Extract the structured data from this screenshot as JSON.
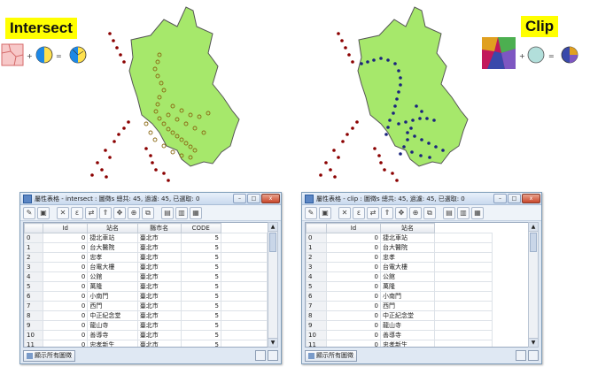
{
  "left_panel": {
    "label": "Intersect",
    "window": {
      "title": "屬性表格 - intersect : 圖徵s 總共: 45, 過濾: 45, 已選取: 0",
      "columns": [
        "Id",
        "站名",
        "縣市名",
        "CODE"
      ],
      "rows": [
        [
          "0",
          "0",
          "捷北車站",
          "臺北市",
          "5"
        ],
        [
          "1",
          "0",
          "台大醫院",
          "臺北市",
          "5"
        ],
        [
          "2",
          "0",
          "忠孝",
          "臺北市",
          "5"
        ],
        [
          "3",
          "0",
          "台電大樓",
          "臺北市",
          "5"
        ],
        [
          "4",
          "0",
          "公館",
          "臺北市",
          "5"
        ],
        [
          "5",
          "0",
          "萬隆",
          "臺北市",
          "5"
        ],
        [
          "6",
          "0",
          "小南門",
          "臺北市",
          "5"
        ],
        [
          "7",
          "0",
          "西門",
          "臺北市",
          "5"
        ],
        [
          "8",
          "0",
          "中正紀念堂",
          "臺北市",
          "5"
        ],
        [
          "9",
          "0",
          "龍山寺",
          "臺北市",
          "5"
        ],
        [
          "10",
          "0",
          "善導寺",
          "臺北市",
          "5"
        ],
        [
          "11",
          "0",
          "忠孝新生",
          "臺北市",
          "5"
        ]
      ],
      "show_all_button": "顯示所有圖徵"
    }
  },
  "right_panel": {
    "label": "Clip",
    "window": {
      "title": "屬性表格 - clip : 圖徵s 總共: 45, 過濾: 45, 已選取: 0",
      "columns": [
        "Id",
        "站名"
      ],
      "rows": [
        [
          "0",
          "0",
          "捷北車站"
        ],
        [
          "1",
          "0",
          "台大醫院"
        ],
        [
          "2",
          "0",
          "忠孝"
        ],
        [
          "3",
          "0",
          "台電大樓"
        ],
        [
          "4",
          "0",
          "公館"
        ],
        [
          "5",
          "0",
          "萬隆"
        ],
        [
          "6",
          "0",
          "小南門"
        ],
        [
          "7",
          "0",
          "西門"
        ],
        [
          "8",
          "0",
          "中正紀念堂"
        ],
        [
          "9",
          "0",
          "龍山寺"
        ],
        [
          "10",
          "0",
          "善導寺"
        ],
        [
          "11",
          "0",
          "忠孝新生"
        ]
      ],
      "show_all_button": "顯示所有圖徵"
    }
  },
  "window_controls": {
    "minimize": "–",
    "maximize": "□",
    "close": "x"
  },
  "operators": {
    "plus": "+",
    "equals": "="
  },
  "colors": {
    "banner": "#ffff00",
    "polygon_fill": "#a6e86b",
    "polygon_stroke": "#555555",
    "point_outside": "#8b0000",
    "point_intersect": "#8b6914",
    "point_clip": "#1a237e"
  }
}
